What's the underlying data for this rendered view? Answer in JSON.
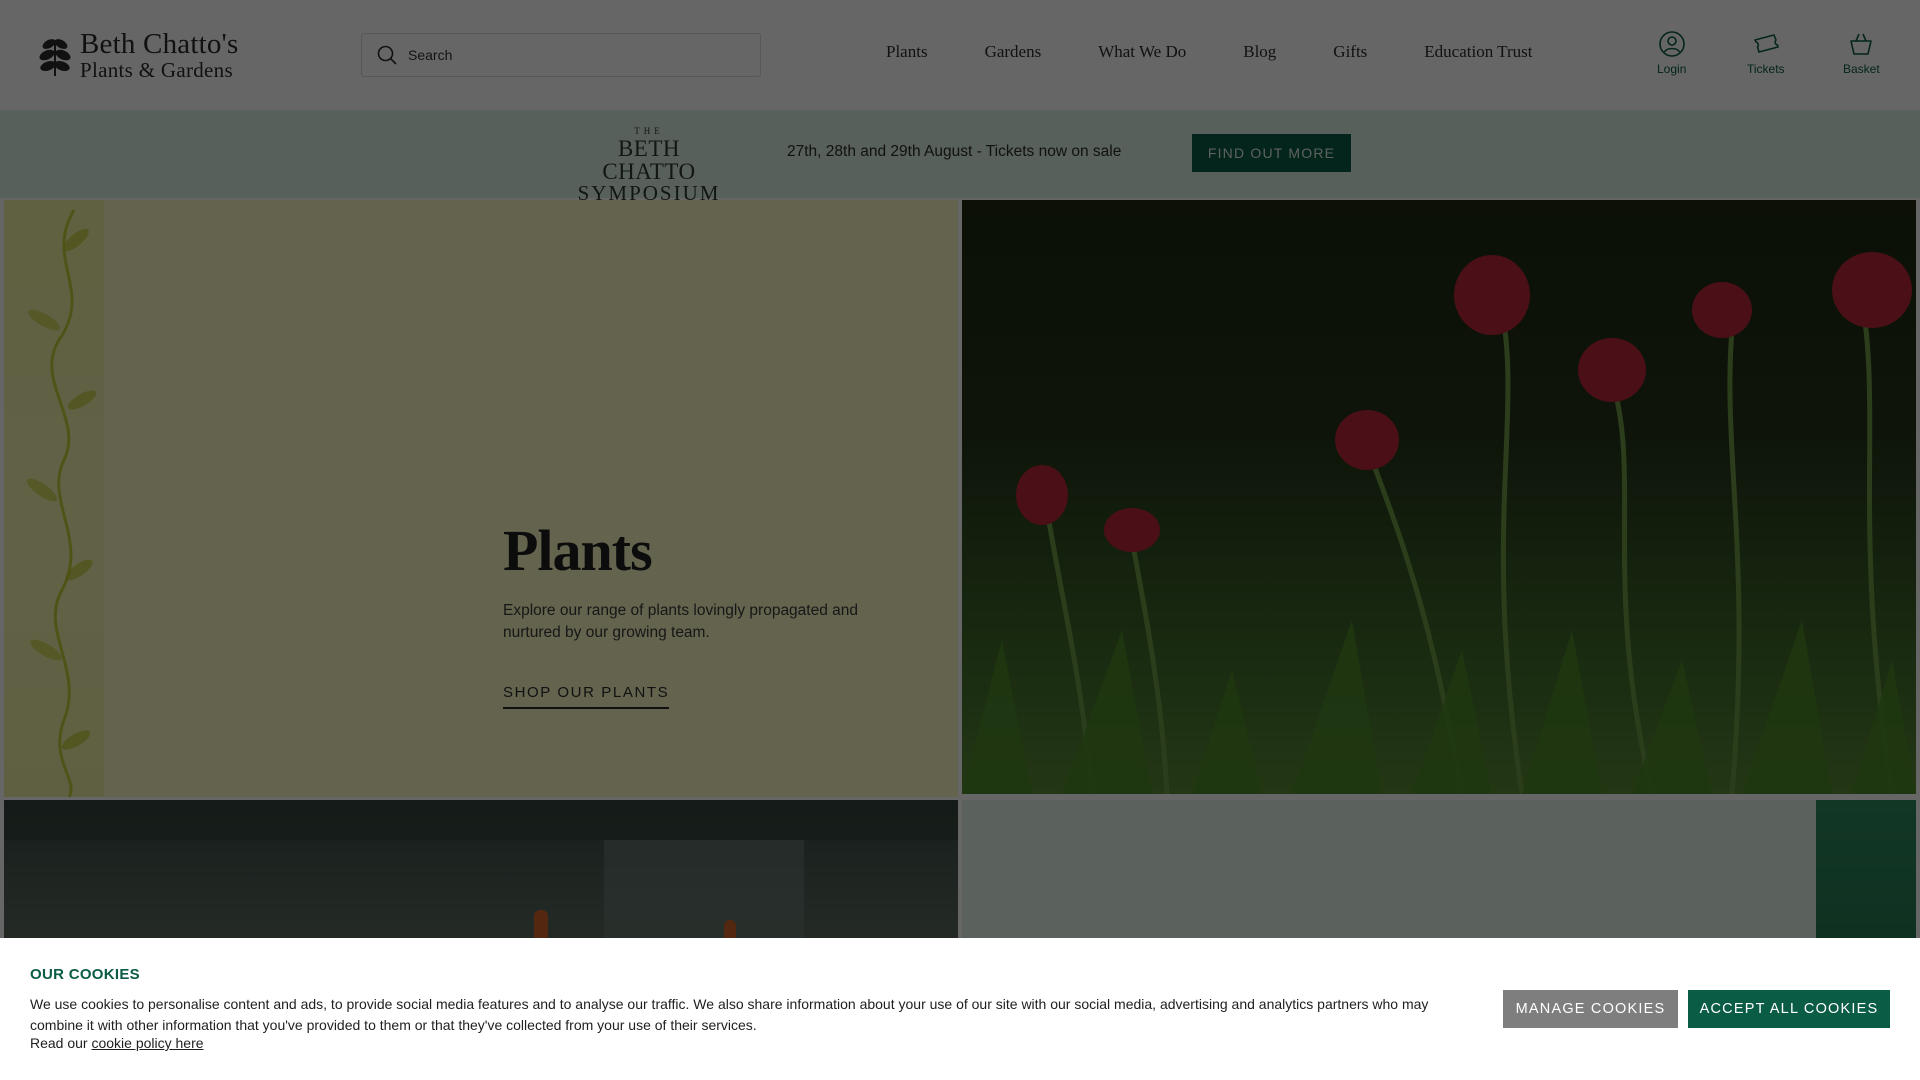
{
  "header": {
    "logo_line1": "Beth Chatto's",
    "logo_line2": "Plants & Gardens",
    "search_placeholder": "Search",
    "nav": [
      "Plants",
      "Gardens",
      "What We Do",
      "Blog",
      "Gifts",
      "Education Trust"
    ],
    "utilities": {
      "login": "Login",
      "tickets": "Tickets",
      "basket": "Basket"
    }
  },
  "banner": {
    "logo_the": "THE",
    "logo_line2": "BETH CHATTO",
    "logo_line3": "SYMPOSIUM",
    "text": "27th, 28th and 29th August - Tickets now on sale",
    "button": "FIND OUT MORE"
  },
  "hero": {
    "title": "Plants",
    "description": "Explore our range of plants lovingly propagated and nurtured by our growing team.",
    "link": "SHOP OUR PLANTS"
  },
  "cookies": {
    "title": "OUR COOKIES",
    "body": "We use cookies to personalise content and ads, to provide social media features and to analyse our traffic. We also share information about your use of our site with our social media, advertising and analytics partners who may combine it with other information that you've provided to them or that they've collected from your use of their services.",
    "read_prefix": "Read our",
    "policy_link": "cookie policy here",
    "manage_button": "MANAGE COOKIES",
    "accept_button": "ACCEPT ALL COOKIES"
  },
  "colors": {
    "brand_green": "#0a5c45",
    "banner_bg": "#dcefe4",
    "plants_tile_bg": "#faf7c2",
    "manage_button_bg": "#7e7e7e"
  },
  "icons": [
    "leaf-logo-icon",
    "search-icon",
    "user-icon",
    "ticket-icon",
    "basket-icon"
  ]
}
